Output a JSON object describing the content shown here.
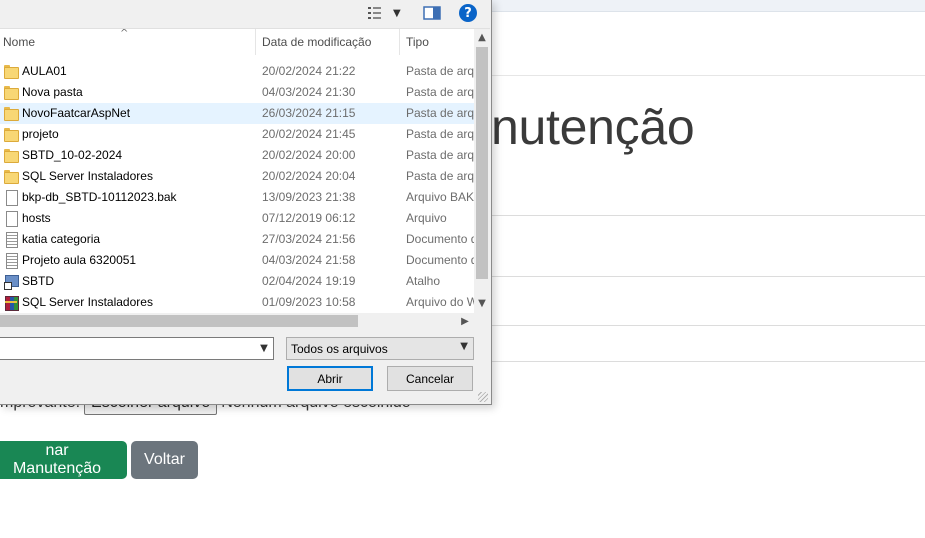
{
  "background_page": {
    "title_fragment": "nutenção",
    "file_input_label": "mprovante:",
    "file_input_button": "Escolher arquivo",
    "file_input_status": "Nenhum arquivo escolhido",
    "primary_button": "nar Manutenção",
    "secondary_button": "Voltar",
    "colors": {
      "primary": "#198754",
      "secondary": "#6c757d"
    }
  },
  "dialog": {
    "toolbar": {
      "view_icon": "view-options-icon",
      "preview_icon": "preview-pane-icon",
      "help_label": "?"
    },
    "columns": {
      "name": "Nome",
      "date": "Data de modificação",
      "type": "Tipo"
    },
    "rows": [
      {
        "name": "AULA01",
        "date": "20/02/2024 21:22",
        "type": "Pasta de arquivos",
        "icon": "folder-icon",
        "selected": false
      },
      {
        "name": "Nova pasta",
        "date": "04/03/2024 21:30",
        "type": "Pasta de arquivos",
        "icon": "folder-icon",
        "selected": false
      },
      {
        "name": "NovoFaatcarAspNet",
        "date": "26/03/2024 21:15",
        "type": "Pasta de arquivos",
        "icon": "folder-icon",
        "selected": true
      },
      {
        "name": "projeto",
        "date": "20/02/2024 21:45",
        "type": "Pasta de arquivos",
        "icon": "folder-icon",
        "selected": false
      },
      {
        "name": "SBTD_10-02-2024",
        "date": "20/02/2024 20:00",
        "type": "Pasta de arquivos",
        "icon": "folder-icon",
        "selected": false
      },
      {
        "name": "SQL Server Instaladores",
        "date": "20/02/2024 20:04",
        "type": "Pasta de arquivos",
        "icon": "folder-icon",
        "selected": false
      },
      {
        "name": "bkp-db_SBTD-10112023.bak",
        "date": "13/09/2023 21:38",
        "type": "Arquivo BAK",
        "icon": "file-icon",
        "selected": false
      },
      {
        "name": "hosts",
        "date": "07/12/2019 06:12",
        "type": "Arquivo",
        "icon": "file-icon",
        "selected": false
      },
      {
        "name": "katia categoria",
        "date": "27/03/2024 21:56",
        "type": "Documento de texto",
        "icon": "text-document-icon",
        "selected": false
      },
      {
        "name": "Projeto aula 6320051",
        "date": "04/03/2024 21:58",
        "type": "Documento de texto",
        "icon": "text-document-icon",
        "selected": false
      },
      {
        "name": "SBTD",
        "date": "02/04/2024 19:19",
        "type": "Atalho",
        "icon": "shortcut-icon",
        "selected": false
      },
      {
        "name": "SQL Server Instaladores",
        "date": "01/09/2023 10:58",
        "type": "Arquivo do WinRAR",
        "icon": "archive-icon",
        "selected": false
      }
    ],
    "filename_value": "",
    "file_type": "Todos os arquivos",
    "open_button": "Abrir",
    "cancel_button": "Cancelar"
  }
}
